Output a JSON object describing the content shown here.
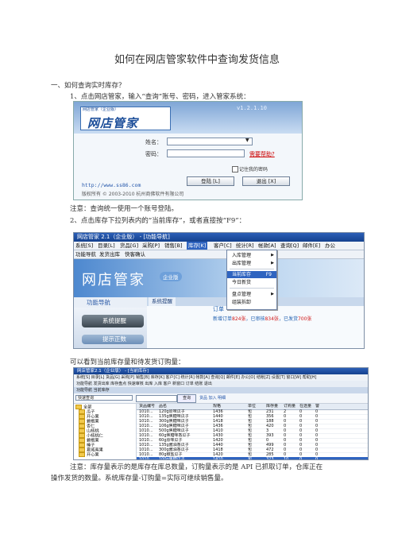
{
  "title": "如何在网店管家软件中查询发货信息",
  "section1": {
    "heading": "一、如何查询实时库存？",
    "step1": "1、点击网店管家，输入“查询”账号、密码，进入管家系统：",
    "note1": "注意：查询统一使用一个账号登陆。",
    "step2": "2、点击库存下拉列表内的“当前库存”，或者直接按“F9”：",
    "step3": "可以看到当前库存量和待发货订购量：",
    "note2_line1": "注意：库存量表示的是库存在库总数量，订购量表示的是 API 已抓取订单，仓库正在",
    "note2_line2": "操作发货的数量。系统库存量-订购量=实际可继续销售量。"
  },
  "login": {
    "logo_sub": "网店管家（企业版）",
    "logo_main": "网店管家",
    "version": "v1.2.1.10",
    "name_label": "姓名：",
    "password_label": "密码：",
    "help": "需要帮助?",
    "remember": "记住我的密码",
    "login_btn": "登陆 [L]",
    "exit_btn": "退出 [X]",
    "url": "http://www.ss86.com",
    "copyright": "版权所有  ©  2003-2010  杭州商佛软件有限公司"
  },
  "nav": {
    "window_title": "网店管家 2.1（企业版）  -  [功能导航]",
    "menu": [
      "系统[S]",
      "目录[L]",
      "货品[G]",
      "采购[P]",
      "销售[B]",
      "库存[K]",
      "客户[C]",
      "统计[R]",
      "帐款[A]",
      "查询[Q]",
      "邮件[E]",
      "办公"
    ],
    "toolbar": [
      "功能导航",
      "发货出库",
      "快客确认"
    ],
    "brand": "网店管家",
    "edition": "企业版",
    "side_header": "功能导航",
    "side_btn1": "系统提醒",
    "side_btn2": "提示正数",
    "tabs": [
      "系统提醒"
    ],
    "order_label": "订单",
    "order_text1": "新增订单",
    "order_num1": "824张",
    "order_text2": "，已审核",
    "order_num2": "834张",
    "order_text3": "，已发货",
    "order_num3": "700张",
    "dropdown": [
      {
        "label": "入库管理",
        "key": "▶"
      },
      {
        "label": "出库管理",
        "key": "▶"
      },
      {
        "label": "当前库存",
        "key": "F9"
      },
      {
        "label": "今日新货",
        "key": ""
      },
      {
        "label": "盘点管理",
        "key": "▶"
      },
      {
        "label": "组装拆卸",
        "key": ""
      }
    ]
  },
  "inventory": {
    "window_title": "网店管家2.1（企业版）  -  [当前库存]",
    "menu": "系统[S]  目录[L]  货品[G]  采购[P]  销售[B]  库存[K]  客户[C]  统计[R]  帐款[A]  查询[Q]  邮件[E]  办公[O]  结帐[Z]  设置[T]  窗口[W]  帮助[H]",
    "toolbar": "功能导航  发货出库  库存盘点  快速审核  出库  入库  客户  新窗口  订单  结账  退出",
    "tabs": "功能导航   当前库存",
    "select": "快速查询",
    "query_btn": "查询",
    "links": "货品    加入  明细",
    "tree": [
      "全部",
      "瓜子",
      "开心果",
      "碧根果",
      "杏仁",
      "山核桃",
      "小核桃仁",
      "碧根果",
      "榛子",
      "夏威夷果",
      "开心果",
      "腰果"
    ],
    "columns": [
      "货品编号",
      "品名",
      "规格",
      "单位",
      "库存量",
      "订购量",
      "在途量",
      "警"
    ],
    "rows": [
      [
        "1010...",
        "120g原味瓜子",
        "1436",
        "包",
        "231",
        "2",
        "0",
        "0"
      ],
      [
        "1010...",
        "135g焦糖味瓜子",
        "1440",
        "包",
        "356",
        "0",
        "0",
        "0"
      ],
      [
        "1010...",
        "300g焦糖味瓜子",
        "1418",
        "包",
        "188",
        "0",
        "0",
        "0"
      ],
      [
        "1010...",
        "106g焦糖味瓜子",
        "1436",
        "包",
        "420",
        "0",
        "0",
        "0"
      ],
      [
        "1010...",
        "500g焦糖味瓜子",
        "1410",
        "包",
        "3",
        "0",
        "0",
        "0"
      ],
      [
        "1010...",
        "60g焦糖味香瓜子",
        "1430",
        "包",
        "393",
        "0",
        "0",
        "0"
      ],
      [
        "1010...",
        "60g原味瓜子",
        "1420",
        "包",
        "0",
        "0",
        "0",
        "0"
      ],
      [
        "1010...",
        "135g酱油香瓜子",
        "1440",
        "包",
        "499",
        "0",
        "0",
        "0"
      ],
      [
        "1010...",
        "300g酱油香瓜子",
        "1418",
        "包",
        "472",
        "0",
        "0",
        "0"
      ],
      [
        "1010...",
        "80g椒盐瓜子",
        "1420",
        "包",
        "285",
        "0",
        "0",
        "0"
      ],
      [
        "1010...",
        "100g焦糖瓜子",
        "1410",
        "包",
        "323",
        "10",
        "0",
        "0"
      ]
    ]
  }
}
